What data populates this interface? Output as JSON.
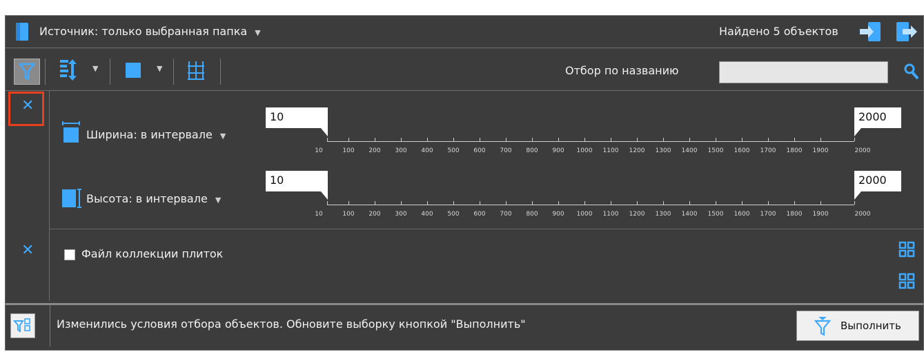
{
  "header": {
    "source_label": "Источник: только выбранная папка",
    "found_label": "Найдено 5 объектов"
  },
  "toolbar": {
    "name_filter_label": "Отбор по названию",
    "name_filter_value": ""
  },
  "filters": {
    "width": {
      "label": "Ширина: в интервале",
      "min_value": "10",
      "max_value": "2000",
      "ticks": [
        "10",
        "100",
        "200",
        "300",
        "400",
        "500",
        "600",
        "700",
        "800",
        "900",
        "1000",
        "1100",
        "1200",
        "1300",
        "1400",
        "1500",
        "1600",
        "1700",
        "1800",
        "1900",
        "2000"
      ]
    },
    "height": {
      "label": "Высота: в интервале",
      "min_value": "10",
      "max_value": "2000",
      "ticks": [
        "10",
        "100",
        "200",
        "300",
        "400",
        "500",
        "600",
        "700",
        "800",
        "900",
        "1000",
        "1100",
        "1200",
        "1300",
        "1400",
        "1500",
        "1600",
        "1700",
        "1800",
        "1900",
        "2000"
      ]
    },
    "tiles": {
      "label": "Файл коллекции плиток",
      "checked": false
    }
  },
  "status": {
    "message": "Изменились условия отбора объектов. Обновите выборку кнопкой \"Выполнить\"",
    "execute_label": "Выполнить"
  },
  "colors": {
    "background": "#3c3c3c",
    "accent": "#3fa9ff",
    "highlight": "#e8401c"
  }
}
